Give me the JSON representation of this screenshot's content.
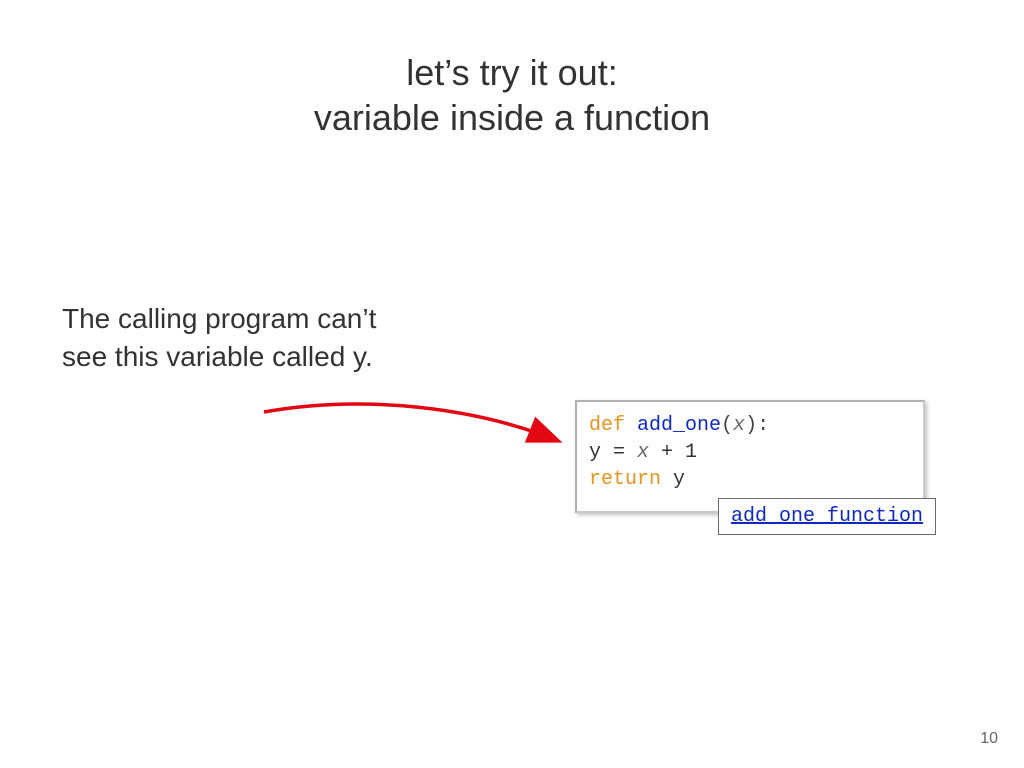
{
  "title": {
    "line1": "let’s try it out:",
    "line2": "variable inside a function"
  },
  "body_text": "The calling program can’t see this variable called y.",
  "code": {
    "def_kw": "def ",
    "fn_name": "add_one",
    "paren_open": "(",
    "param": "x",
    "paren_close_colon": "):",
    "line2_before_x": "y = ",
    "line2_x": "x",
    "line2_after_x": " + 1",
    "return_kw": "return ",
    "return_val": "y"
  },
  "link_label": "add_one_function",
  "page_number": "10"
}
